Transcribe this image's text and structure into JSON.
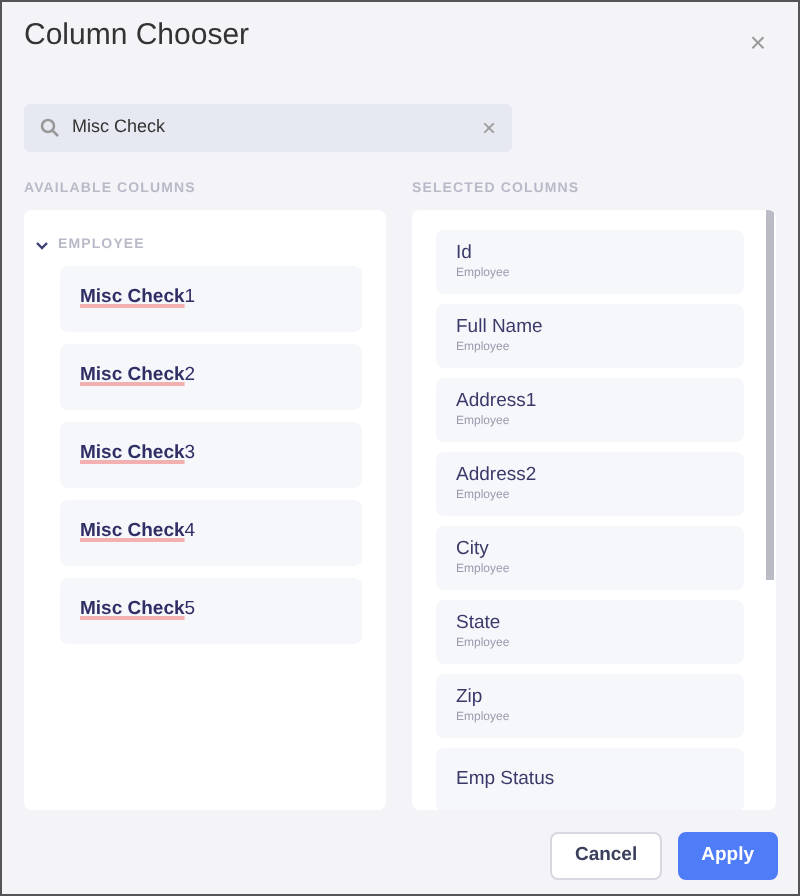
{
  "dialog": {
    "title": "Column Chooser",
    "close": "×"
  },
  "search": {
    "value": "Misc Check",
    "clear": "×"
  },
  "available": {
    "heading": "AVAILABLE COLUMNS",
    "groups": [
      {
        "label": "EMPLOYEE",
        "expanded": true,
        "items": [
          {
            "label": "**Misc Check**1"
          },
          {
            "label": "**Misc Check**2"
          },
          {
            "label": "**Misc Check**3"
          },
          {
            "label": "**Misc Check**4"
          },
          {
            "label": "**Misc Check**5"
          }
        ]
      }
    ]
  },
  "selected": {
    "heading": "SELECTED COLUMNS",
    "items": [
      {
        "label": "Id",
        "group": "Employee"
      },
      {
        "label": "Full Name",
        "group": "Employee"
      },
      {
        "label": "Address1",
        "group": "Employee"
      },
      {
        "label": "Address2",
        "group": "Employee"
      },
      {
        "label": "City",
        "group": "Employee"
      },
      {
        "label": "State",
        "group": "Employee"
      },
      {
        "label": "Zip",
        "group": "Employee"
      },
      {
        "label": "Emp Status"
      }
    ]
  },
  "buttons": [
    {
      "label": "Cancel",
      "kind": "secondary"
    },
    {
      "label": "Apply",
      "kind": "primary"
    }
  ]
}
